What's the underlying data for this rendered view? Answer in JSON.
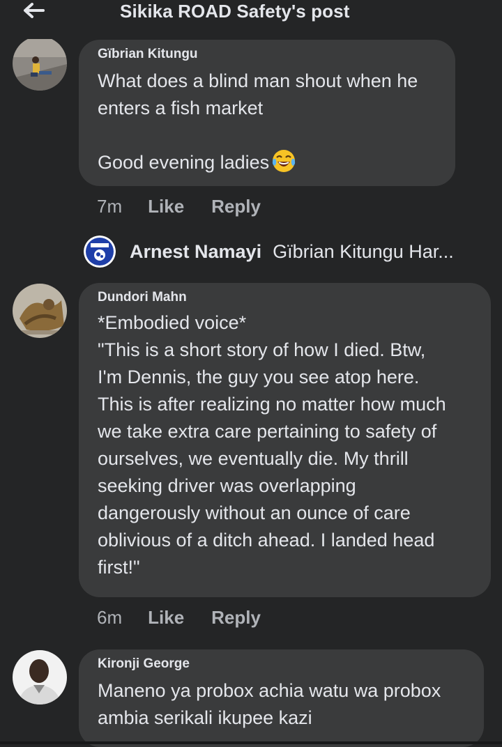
{
  "header": {
    "title": "Sikika ROAD Safety's post"
  },
  "comments": [
    {
      "author": "Gïbrian Kitungu",
      "text": "What does a blind man shout when he\nenters a fish market\n\nGood evening ladies",
      "emoji": "tears-of-joy-emoji",
      "time": "7m",
      "like": "Like",
      "reply": "Reply"
    },
    {
      "author": "Dundori Mahn",
      "text": "*Embodied voice*\n\"This is a short story of how I died. Btw,\nI'm Dennis, the guy you see atop here.\nThis is after realizing no matter how much\nwe take extra care pertaining to safety of\nourselves, we eventually die. My thrill\nseeking driver was overlapping\ndangerously without an ounce of care\noblivious of a ditch ahead. I landed head\nfirst!\"",
      "time": "6m",
      "like": "Like",
      "reply": "Reply"
    },
    {
      "author": "Kironji George",
      "text": "Maneno ya probox achia watu wa probox\nambia serikali ikupee kazi"
    }
  ],
  "reply_preview": {
    "author": "Arnest Namayi",
    "text": "Gïbrian Kitungu Har..."
  },
  "colors": {
    "background": "#242526",
    "bubble": "#3a3b3c",
    "muted": "#b0b3b8",
    "text": "#e4e6eb"
  }
}
